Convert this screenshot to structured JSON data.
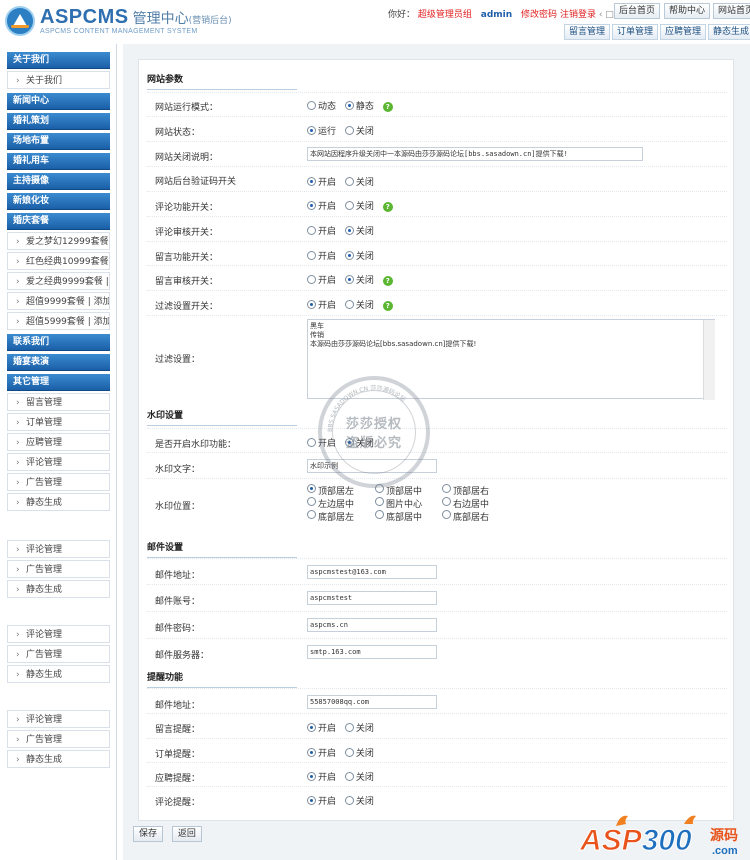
{
  "header": {
    "brand_name": "ASPCMS",
    "brand_cn": "管理中心",
    "brand_sub": "(营销后台)",
    "tagline": "ASPCMS CONTENT MANAGEMENT SYSTEM",
    "greeting": "你好：",
    "role": "超级管理员组",
    "username": "admin",
    "change_password": "修改密码",
    "logout": "注销登录",
    "toggle_icon": "‹ □ ›",
    "top_buttons": [
      "后台首页",
      "帮助中心",
      "网站首页"
    ],
    "sub_tabs": [
      "留言管理",
      "订单管理",
      "应聘管理",
      "静态生成"
    ]
  },
  "sidebar": {
    "sections": [
      {
        "title": "关于我们",
        "items": [
          "关于我们"
        ]
      },
      {
        "title": "新闻中心",
        "items": []
      },
      {
        "title": "婚礼策划",
        "items": []
      },
      {
        "title": "场地布置",
        "items": []
      },
      {
        "title": "婚礼用车",
        "items": []
      },
      {
        "title": "主持摄像",
        "items": []
      },
      {
        "title": "新娘化妆",
        "items": []
      },
      {
        "title": "婚庆套餐",
        "items": [
          "爱之梦幻12999套餐",
          "红色经典10999套餐",
          "爱之经典9999套餐 |",
          "超值9999套餐 | 添加",
          "超值5999套餐 | 添加"
        ]
      },
      {
        "title": "联系我们",
        "items": []
      },
      {
        "title": "婚宴表演",
        "items": []
      },
      {
        "title": "其它管理",
        "items": [
          "留言管理",
          "订单管理",
          "应聘管理",
          "评论管理",
          "广告管理",
          "静态生成"
        ]
      }
    ],
    "extra_groups": [
      [
        "评论管理",
        "广告管理",
        "静态生成"
      ],
      [
        "评论管理",
        "广告管理",
        "静态生成"
      ],
      [
        "评论管理",
        "广告管理",
        "静态生成"
      ]
    ]
  },
  "form": {
    "site_params": {
      "title": "网站参数",
      "run_mode": {
        "label": "网站运行模式：",
        "options": [
          "动态",
          "静态"
        ],
        "selected": "静态"
      },
      "status": {
        "label": "网站状态：",
        "options": [
          "运行",
          "关闭"
        ],
        "selected": "运行"
      },
      "close_note": {
        "label": "网站关闭说明：",
        "value": "本网站因程序升级关闭中一本源码由莎莎源码论坛[bbs.sasadown.cn]提供下载!"
      },
      "captcha": {
        "label": "网站后台验证码开关",
        "options": [
          "开启",
          "关闭"
        ],
        "selected": "开启"
      },
      "comment": {
        "label": "评论功能开关：",
        "options": [
          "开启",
          "关闭"
        ],
        "selected": "开启"
      },
      "comment_review": {
        "label": "评论审核开关：",
        "options": [
          "开启",
          "关闭"
        ],
        "selected": "关闭"
      },
      "message": {
        "label": "留言功能开关：",
        "options": [
          "开启",
          "关闭"
        ],
        "selected": "关闭"
      },
      "message_review": {
        "label": "留言审核开关：",
        "options": [
          "开启",
          "关闭"
        ],
        "selected": "关闭"
      },
      "filter_switch": {
        "label": "过滤设置开关：",
        "options": [
          "开启",
          "关闭"
        ],
        "selected": "开启"
      },
      "filter": {
        "label": "过滤设置：",
        "lines": [
          "黑车",
          "传销",
          "本源码由莎莎源码论坛[bbs.sasadown.cn]提供下载!"
        ]
      }
    },
    "watermark": {
      "title": "水印设置",
      "enable": {
        "label": "是否开启水印功能：",
        "options": [
          "开启",
          "关闭"
        ],
        "selected": "关闭"
      },
      "text": {
        "label": "水印文字：",
        "value": "水印示例"
      },
      "position": {
        "label": "水印位置：",
        "options": [
          "顶部居左",
          "顶部居中",
          "顶部居右",
          "左边居中",
          "图片中心",
          "右边居中",
          "底部居左",
          "底部居中",
          "底部居右"
        ],
        "selected": "顶部居左"
      }
    },
    "mail": {
      "title": "邮件设置",
      "address": {
        "label": "邮件地址：",
        "value": "aspcmstest@163.com"
      },
      "account": {
        "label": "邮件账号：",
        "value": "aspcmstest"
      },
      "password": {
        "label": "邮件密码：",
        "value": "aspcms.cn"
      },
      "server": {
        "label": "邮件服务器：",
        "value": "smtp.163.com"
      }
    },
    "reminder": {
      "title": "提醒功能",
      "address": {
        "label": "邮件地址：",
        "value": "55857008qq.com"
      },
      "message": {
        "label": "留言提醒：",
        "options": [
          "开启",
          "关闭"
        ],
        "selected": "开启"
      },
      "order": {
        "label": "订单提醒：",
        "options": [
          "开启",
          "关闭"
        ],
        "selected": "开启"
      },
      "job": {
        "label": "应聘提醒：",
        "options": [
          "开启",
          "关闭"
        ],
        "selected": "开启"
      },
      "comment": {
        "label": "评论提醒：",
        "options": [
          "开启",
          "关闭"
        ],
        "selected": "开启"
      }
    },
    "buttons": {
      "save": "保存",
      "back": "返回"
    }
  },
  "stamp": {
    "line1": "莎莎授权",
    "line2": "盗版必究",
    "ring": "BBS.SASADOWN.CN 莎莎源码论坛"
  },
  "watermark_logo": {
    "text": "ASP300",
    "suffix": "源码",
    "url": ".com"
  },
  "colors": {
    "accent": "#1b5fa7",
    "danger": "#e02020",
    "help": "#5ab630"
  }
}
